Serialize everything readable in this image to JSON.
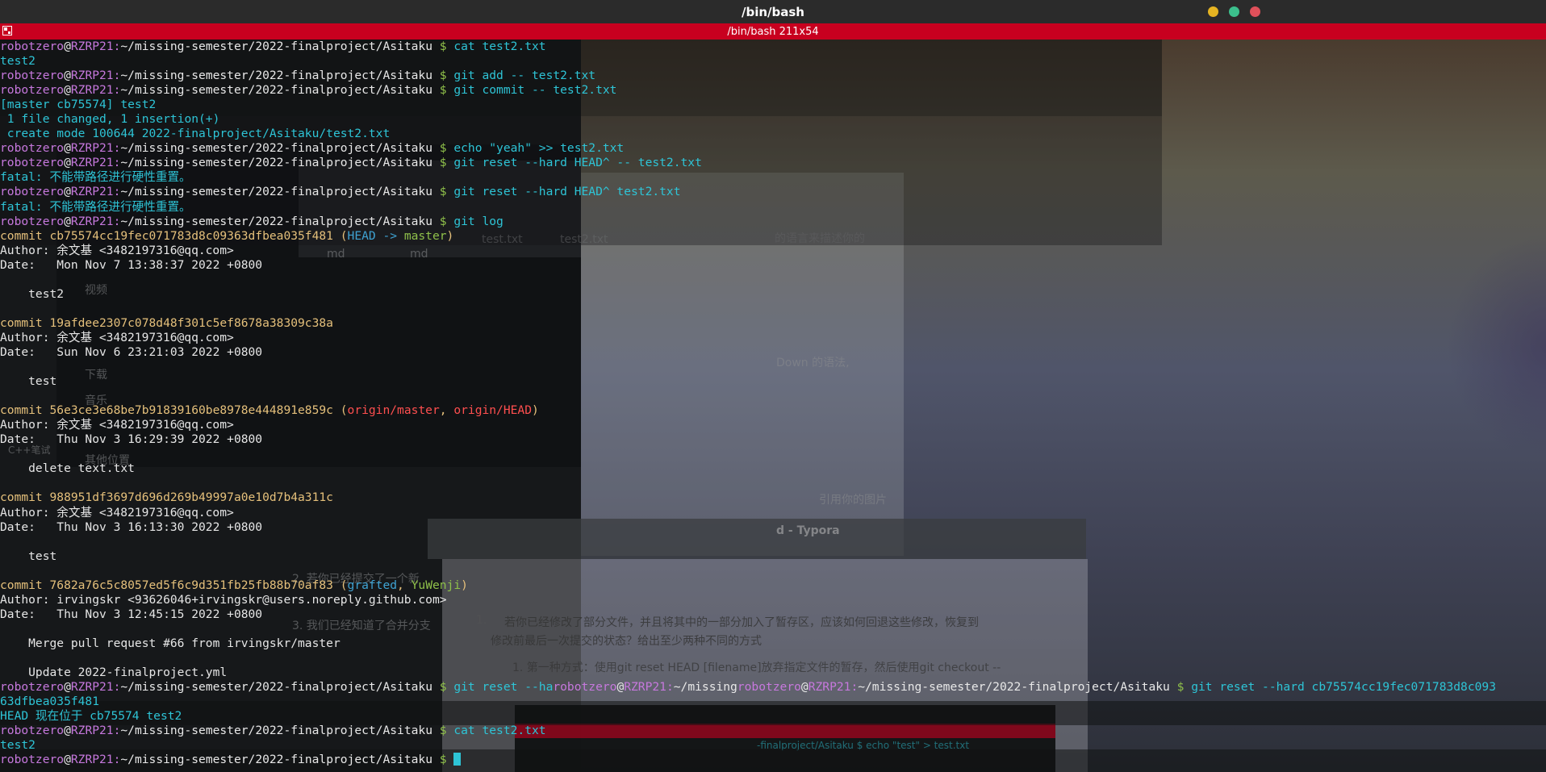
{
  "window": {
    "title": "/bin/bash",
    "tab_title": "/bin/bash 211x54",
    "buttons": {
      "minimize_color": "#e6b422",
      "maximize_color": "#3cbf8c",
      "close_color": "#e0505a"
    }
  },
  "colors": {
    "tab_bg": "#c8001f",
    "user": "#c678dd",
    "path": "#e8e8e8",
    "command": "#2ec4d6",
    "hash": "#e5c07b",
    "branch_head": "#3fa3d3",
    "branch_local": "#8fc04a",
    "branch_remote": "#ff4f4f"
  },
  "prompt": {
    "user": "robotzero",
    "at": "@",
    "host": "RZRP21",
    "sep": ":",
    "path": "~/missing-semester/2022-finalproject/Asitaku",
    "dollar": " $ "
  },
  "background_text": {
    "tab1": "test.txt",
    "tab2": "test2.txt",
    "md1": "md",
    "md2": "md",
    "side1": "视频",
    "side2": "下载",
    "side3": "音乐",
    "side4": "其他位置",
    "typora_title": "d - Typora",
    "doc1": "的语言来描述你的",
    "doc2": "Down 的语法,",
    "doc3": "引用你的图片",
    "doc4": "2. 若你已经提交了一个新",
    "doc5": "3. 我们已经知道了合并分支",
    "doc_q": "若你已经修改了部分文件，并且将其中的一部分加入了暂存区，应该如何回退这些修改，恢复到",
    "doc_q2": "修改前最后一次提交的状态？给出至少两种不同的方式",
    "doc_a": "1. 第一种方式：使用git reset HEAD [filename]放弃指定文件的暂存，然后使用git checkout --",
    "doc_t": "-finalproject/Asitaku $ echo \"test\" > test.txt",
    "doc_l1": "1.",
    "doc_ls": "C++笔试"
  },
  "terminal": {
    "commands": {
      "c1": "cat test2.txt",
      "c2": "git add -- test2.txt",
      "c3": "git commit -- test2.txt",
      "c4": "echo \"yeah\" >> test2.txt",
      "c5": "git reset --hard HEAD^ -- test2.txt",
      "c6": "git reset --hard HEAD^ test2.txt",
      "c7": "git log",
      "c8a": "git reset --ha",
      "c8b": "/missing",
      "c8c": "git reset --hard cb75574cc19fec071783d8c093",
      "c9": "cat test2.txt"
    },
    "outputs": {
      "o1": "test2",
      "o2": "[master cb75574] test2",
      "o3": " 1 file changed, 1 insertion(+)",
      "o4": " create mode 100644 2022-finalproject/Asitaku/test2.txt",
      "fatal": "fatal: 不能带路径进行硬性重置。",
      "wrap": "63dfbea035f481",
      "head_now": "HEAD 现在位于 cb75574 test2",
      "o_last": "test2"
    },
    "commits": [
      {
        "line": "commit cb75574cc19fec071783d8c09363dfbea035f481",
        "refs_open": " (",
        "head_ref": "HEAD -> ",
        "branch": "master",
        "refs_close": ")",
        "author": "Author: 余文基 <3482197316@qq.com>",
        "date": "Date:   Mon Nov 7 13:38:37 2022 +0800",
        "msg": "    test2"
      },
      {
        "line": "commit 19afdee2307c078d48f301c5ef8678a38309c38a",
        "author": "Author: 余文基 <3482197316@qq.com>",
        "date": "Date:   Sun Nov 6 23:21:03 2022 +0800",
        "msg": "    test"
      },
      {
        "line": "commit 56e3ce3e68be7b91839160be8978e444891e859c",
        "refs_open": " (",
        "remote1": "origin/master",
        "comma": ", ",
        "remote2": "origin/HEAD",
        "refs_close": ")",
        "author": "Author: 余文基 <3482197316@qq.com>",
        "date": "Date:   Thu Nov 3 16:29:39 2022 +0800",
        "msg": "    delete text.txt"
      },
      {
        "line": "commit 988951df3697d696d269b49997a0e10d7b4a311c",
        "author": "Author: 余文基 <3482197316@qq.com>",
        "date": "Date:   Thu Nov 3 16:13:30 2022 +0800",
        "msg": "    test"
      },
      {
        "line": "commit 7682a76c5c8057ed5f6c9d351fb25fb88b70af83",
        "refs_open": " (",
        "tag1": "grafted",
        "comma": ", ",
        "tag2": "YuWenji",
        "refs_close": ")",
        "author": "Author: irvingskr <93626046+irvingskr@users.noreply.github.com>",
        "date": "Date:   Thu Nov 3 12:45:15 2022 +0800",
        "msg": "    Merge pull request #66 from irvingskr/master",
        "msg2": "    Update 2022-finalproject.yml"
      }
    ]
  }
}
